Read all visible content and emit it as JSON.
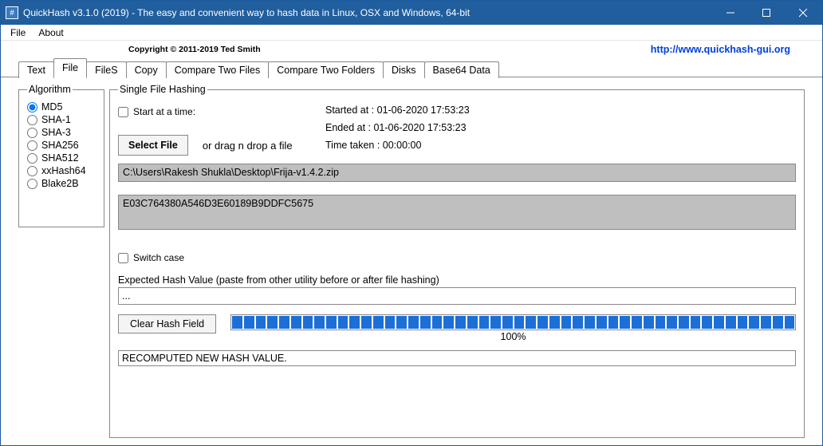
{
  "window": {
    "title": "QuickHash v3.1.0 (2019) - The easy and convenient way to hash data in Linux, OSX and Windows, 64-bit",
    "icon_char": "#"
  },
  "menu": {
    "file": "File",
    "about": "About"
  },
  "header": {
    "copyright": "Copyright © 2011-2019  Ted Smith",
    "url": "http://www.quickhash-gui.org"
  },
  "tabs": {
    "text": "Text",
    "file": "File",
    "files": "FileS",
    "copy": "Copy",
    "compare_two_files": "Compare Two Files",
    "compare_two_folders": "Compare Two Folders",
    "disks": "Disks",
    "base64": "Base64 Data"
  },
  "algorithm": {
    "legend": "Algorithm",
    "options": {
      "md5": "MD5",
      "sha1": "SHA-1",
      "sha3": "SHA-3",
      "sha256": "SHA256",
      "sha512": "SHA512",
      "xxhash64": "xxHash64",
      "blake2b": "Blake2B"
    },
    "selected": "md5"
  },
  "single": {
    "legend": "Single File Hashing",
    "start_at_time_label": "Start at a time:",
    "started_label": "Started at : 01-06-2020 17:53:23",
    "ended_label": "Ended at : 01-06-2020 17:53:23",
    "time_taken_label": "Time taken : 00:00:00",
    "select_file_btn": "Select File",
    "drag_hint": "or drag n drop a file",
    "file_path": "C:\\Users\\Rakesh Shukla\\Desktop\\Frija-v1.4.2.zip",
    "hash_value": "E03C764380A546D3E60189B9DDFC5675",
    "switch_case_label": "Switch case",
    "expected_label": "Expected Hash Value (paste from other utility before or after file hashing)",
    "expected_value": "...",
    "clear_btn": "Clear Hash Field",
    "progress_pct": "100%",
    "status": "RECOMPUTED NEW HASH VALUE."
  }
}
